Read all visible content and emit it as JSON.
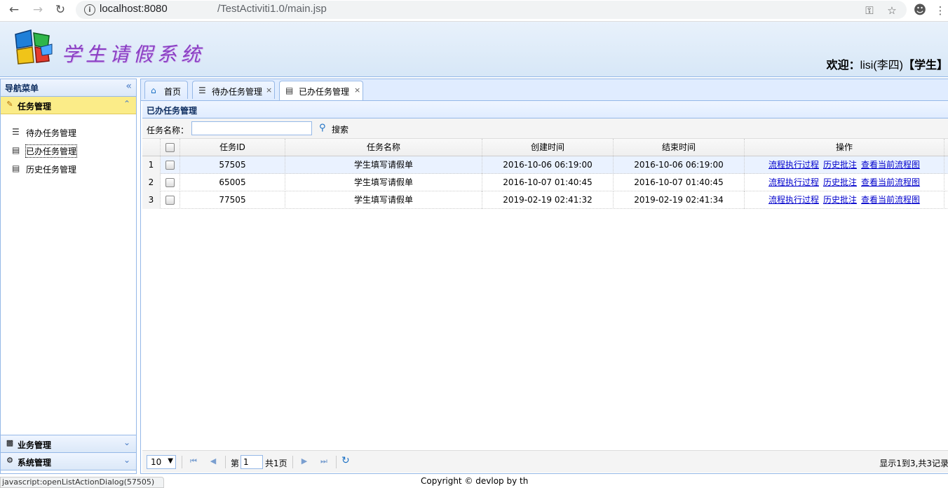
{
  "browser": {
    "url_host": "localhost:8080",
    "url_path": "/TestActiviti1.0/main.jsp"
  },
  "header": {
    "app_title": "学生请假系统",
    "welcome_prefix": "欢迎：",
    "welcome_user": "lisi(李四)",
    "welcome_role": "【学生】"
  },
  "leftnav": {
    "title": "导航菜单",
    "sections": [
      {
        "label": "任务管理",
        "icon": "edit-icon",
        "expanded": true,
        "items": [
          {
            "label": "待办任务管理",
            "icon": "list-icon"
          },
          {
            "label": "已办任务管理",
            "icon": "done-list-icon"
          },
          {
            "label": "历史任务管理",
            "icon": "history-icon"
          }
        ]
      },
      {
        "label": "业务管理",
        "icon": "users-icon",
        "expanded": false
      },
      {
        "label": "系统管理",
        "icon": "settings-icon",
        "expanded": false
      }
    ]
  },
  "tabs": [
    {
      "label": "首页",
      "icon": "home-icon",
      "closable": false
    },
    {
      "label": "待办任务管理",
      "icon": "list-icon",
      "closable": true
    },
    {
      "label": "已办任务管理",
      "icon": "done-list-icon",
      "closable": true,
      "active": true
    }
  ],
  "panel": {
    "title": "已办任务管理",
    "search_label": "任务名称：",
    "search_value": "",
    "search_button": "搜索"
  },
  "grid": {
    "columns": [
      "任务ID",
      "任务名称",
      "创建时间",
      "结束时间",
      "操作"
    ],
    "rows": [
      {
        "num": "1",
        "id": "57505",
        "name": "学生填写请假单",
        "created": "2016-10-06 06:19:00",
        "ended": "2016-10-06 06:19:00"
      },
      {
        "num": "2",
        "id": "65005",
        "name": "学生填写请假单",
        "created": "2016-10-07 01:40:45",
        "ended": "2016-10-07 01:40:45"
      },
      {
        "num": "3",
        "id": "77505",
        "name": "学生填写请假单",
        "created": "2019-02-19 02:41:32",
        "ended": "2019-02-19 02:41:34"
      }
    ],
    "actions": [
      "流程执行过程",
      "历史批注",
      "查看当前流程图"
    ]
  },
  "pager": {
    "page_size": "10",
    "page_prefix": "第",
    "page_value": "1",
    "page_total": "共1页",
    "info": "显示1到3,共3记录"
  },
  "status_bar": "javascript:openListActionDialog(57505)",
  "footer": "Copyright © devlop by th"
}
